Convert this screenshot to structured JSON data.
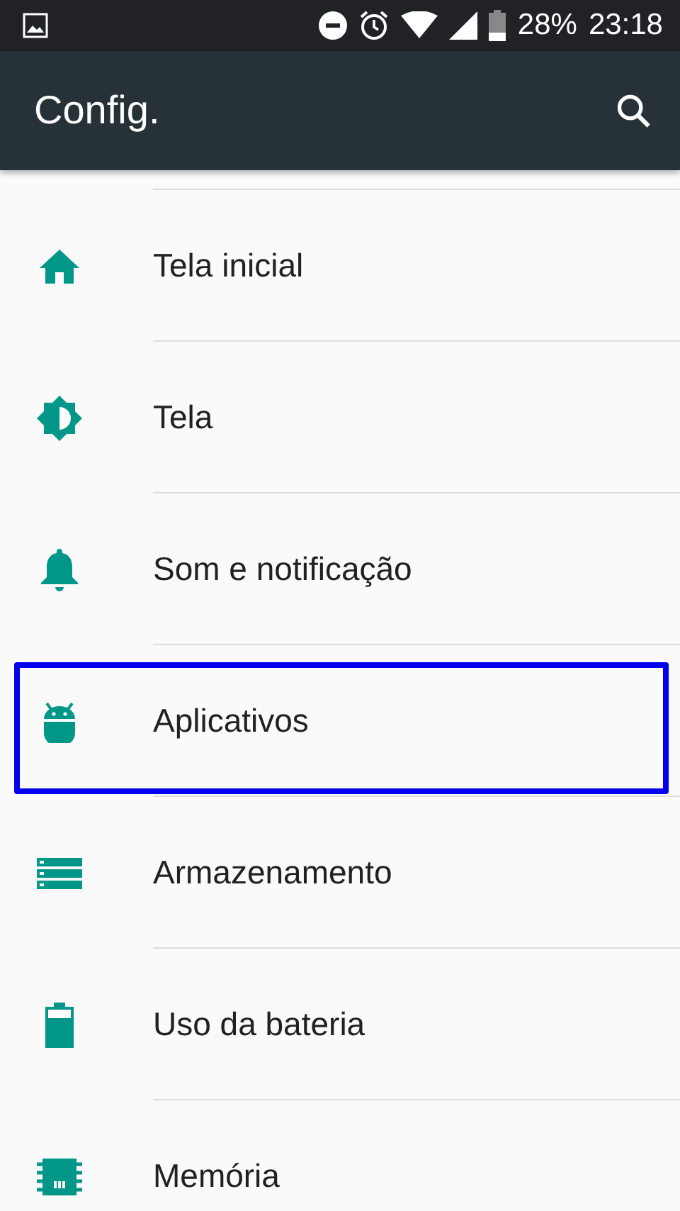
{
  "status_bar": {
    "battery_text": "28%",
    "time": "23:18"
  },
  "toolbar": {
    "title": "Config."
  },
  "items": [
    {
      "kind": "home",
      "label": "Tela inicial",
      "highlighted": false
    },
    {
      "kind": "brightness",
      "label": "Tela",
      "highlighted": false
    },
    {
      "kind": "bell",
      "label": "Som e notificação",
      "highlighted": false
    },
    {
      "kind": "android",
      "label": "Aplicativos",
      "highlighted": true
    },
    {
      "kind": "storage",
      "label": "Armazenamento",
      "highlighted": false
    },
    {
      "kind": "battery",
      "label": "Uso da bateria",
      "highlighted": false
    },
    {
      "kind": "chip",
      "label": "Memória",
      "highlighted": false
    }
  ]
}
